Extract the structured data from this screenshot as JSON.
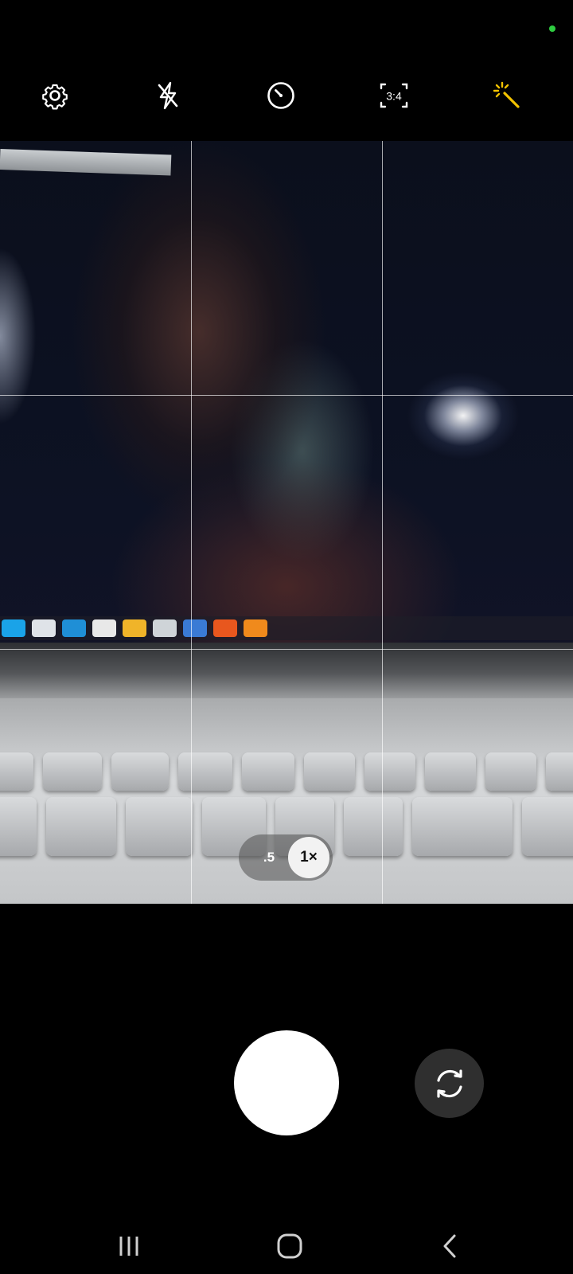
{
  "status": {
    "indicator_color": "#2ecc40"
  },
  "toolbar": {
    "accent_color": "#f2c200",
    "items": [
      {
        "name": "settings",
        "icon": "gear-icon"
      },
      {
        "name": "flash",
        "icon": "flash-off-icon"
      },
      {
        "name": "timer",
        "icon": "timer-icon"
      },
      {
        "name": "aspect-ratio",
        "icon": "aspect-ratio-icon",
        "label": "3:4"
      },
      {
        "name": "effects",
        "icon": "magic-wand-icon"
      }
    ]
  },
  "viewfinder": {
    "grid": true
  },
  "zoom": {
    "options": [
      ".5",
      "1×"
    ],
    "selected": "1×"
  },
  "controls": {
    "shutter_icon": "shutter-button",
    "switch_icon": "switch-camera-icon"
  },
  "navbar": {
    "items": [
      "recent-apps-icon",
      "home-icon",
      "back-icon"
    ]
  }
}
